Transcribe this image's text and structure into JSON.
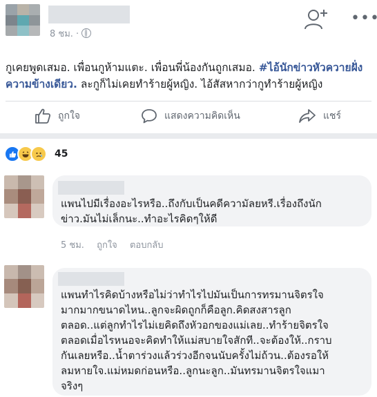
{
  "post": {
    "timestamp": "8 ชม. ·",
    "text_plain": "กูเคยพูดเสมอ. เพื่อนกูห้ามแตะ. เพื่อนพี่น้องกันถูกเสมอ. ",
    "hashtag": "#ไอ้นักข่าวหัวควายฝั่งความข้างเดียว.",
    "text_after": " ละกูก็ไม่เคยทำร้ายผู้หญิง. ไอ้สัสหากว่ากูทำร้ายผู้หญิง",
    "icons": [
      "add-friend-icon",
      "more-icon",
      "globe-icon"
    ]
  },
  "actions": {
    "like_label": "ถูกใจ",
    "comment_label": "แสดงความคิดเห็น",
    "share_label": "แชร์"
  },
  "reactions": {
    "icons": [
      "like-icon",
      "haha-icon",
      "sad-icon"
    ],
    "count": "45"
  },
  "comments": [
    {
      "lines": [
        "แพนไปมีเรื่องอะไรหรือ..ถึงกับเป็นคดีความัลยหรี.เรื่องถึงนัก",
        "ข่าว.มันไม่เล็กนะ..ทำอะไรคิดๆให้ดี"
      ],
      "time": "5 ชม.",
      "like_label": "ถูกใจ",
      "reply_label": "ตอบกลับ"
    },
    {
      "lines": [
        "แพนทำไรคิดบ้างหรือไม่ว่าทำไรไปมันเป็นการทรมานจิตรใจ",
        "มากมากขนาดไหน..ลูกจะผิดถูกก็คือลูก.คิดสงสารลูก",
        "ตลอด..แต่ลูกทำไรไม่เยคิดถึงหัวอกของแม่เลย..ทำร้ายจิตรใจ",
        "ตลอดเมื่อไรหนอจะคิดทำให้แม่สบายใจสักที..จะต้องให้..กราบ",
        "กันเลยหรือ..น้ำตาร่วงแล้วร่วงอีกจนนับครั้งไม่ถ้วน..ต้องรอให้",
        "ลมหายใจ.แม่หมดก่อนหรือ..ลูกนะลูก..มันทรมานจิตรใจแมา",
        "จริงๆ"
      ]
    }
  ]
}
